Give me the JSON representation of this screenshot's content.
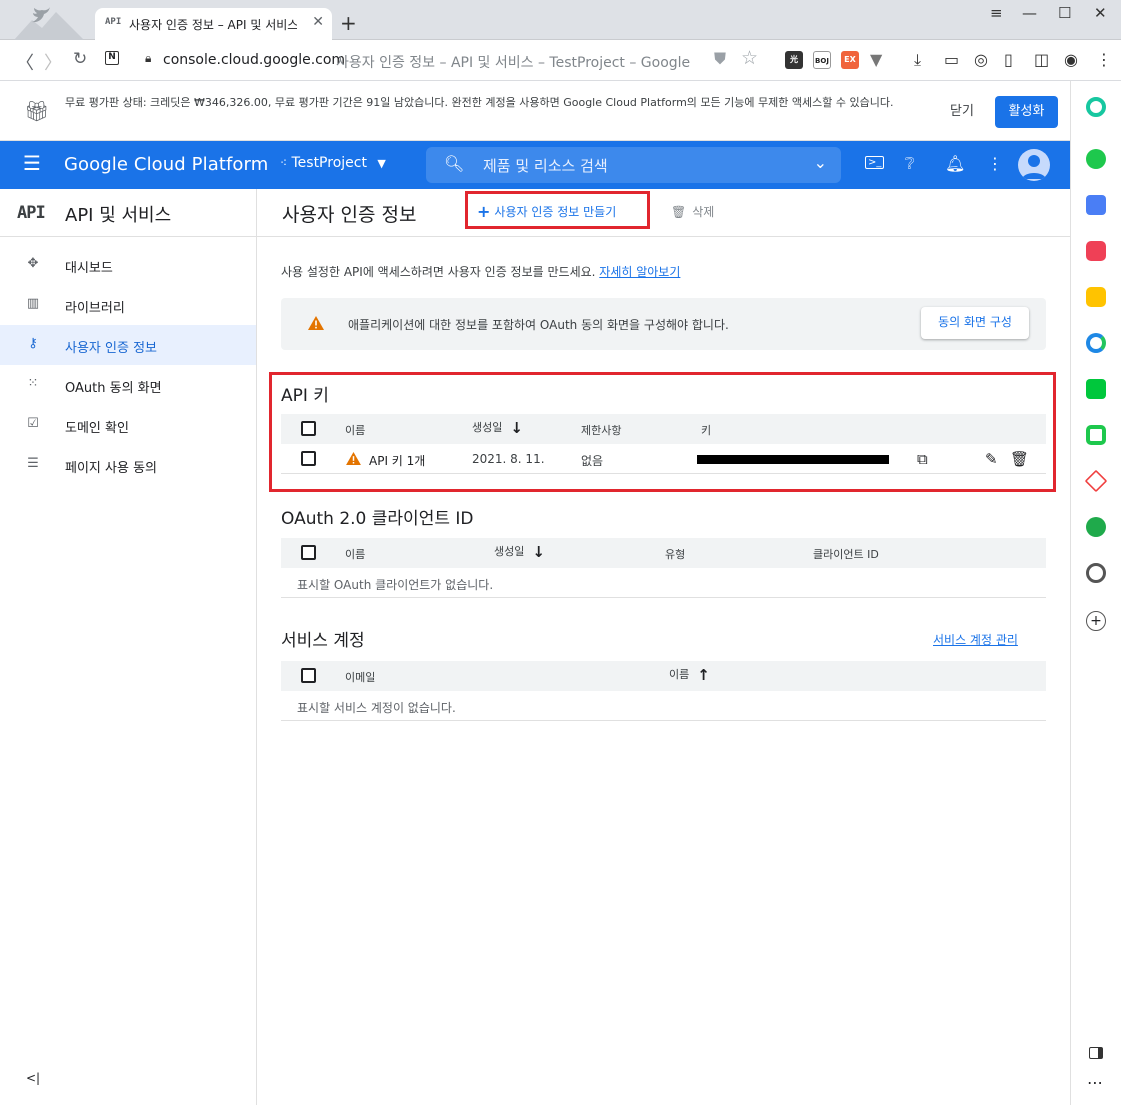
{
  "browser": {
    "tab_favicon": "API",
    "tab_title": "사용자 인증 정보 – API 및 서비스",
    "url_host": "console.cloud.google.com",
    "url_rest": "사용자 인증 정보 – API 및 서비스 – TestProject – Google",
    "ext_labels": [
      "光",
      "BOJ",
      "EX"
    ]
  },
  "promo": {
    "message": "무료 평가판 상태: 크레딧은 ₩346,326.00, 무료 평가판 기간은 91일 남았습니다. 완전한 계정을 사용하면 Google Cloud Platform의 모든 기능에 무제한 액세스할 수 있습니다.",
    "close": "닫기",
    "activate": "활성화"
  },
  "gcp": {
    "brand": "Google Cloud Platform",
    "project": "TestProject",
    "search_placeholder": "제품 및 리소스 검색"
  },
  "sidebar": {
    "logo": "API",
    "title": "API 및 서비스",
    "items": [
      {
        "label": "대시보드",
        "icon": "dashboard-icon"
      },
      {
        "label": "라이브러리",
        "icon": "library-icon"
      },
      {
        "label": "사용자 인증 정보",
        "icon": "key-icon"
      },
      {
        "label": "OAuth 동의 화면",
        "icon": "consent-icon"
      },
      {
        "label": "도메인 확인",
        "icon": "domain-check-icon"
      },
      {
        "label": "페이지 사용 동의",
        "icon": "page-usage-icon"
      }
    ],
    "collapse": "<|"
  },
  "page": {
    "title": "사용자 인증 정보",
    "create": "사용자 인증 정보 만들기",
    "delete": "삭제",
    "intro": "사용 설정한 API에 액세스하려면 사용자 인증 정보를 만드세요.",
    "learn_more": "자세히 알아보기",
    "warning": "애플리케이션에 대한 정보를 포함하여 OAuth 동의 화면을 구성해야 합니다.",
    "configure": "동의 화면 구성"
  },
  "api_keys": {
    "title": "API 키",
    "columns": [
      "이름",
      "생성일",
      "제한사항",
      "키"
    ],
    "rows": [
      {
        "name": "API 키 1개",
        "created": "2021. 8. 11.",
        "restrictions": "없음"
      }
    ]
  },
  "oauth": {
    "title": "OAuth 2.0 클라이언트 ID",
    "columns": [
      "이름",
      "생성일",
      "유형",
      "클라이언트 ID"
    ],
    "empty": "표시할 OAuth 클라이언트가 없습니다."
  },
  "service_accounts": {
    "title": "서비스 계정",
    "manage": "서비스 계정 관리",
    "columns": [
      "이메일",
      "이름"
    ],
    "empty": "표시할 서비스 계정이 없습니다."
  },
  "colors": {
    "primary": "#1a73e8",
    "highlight": "#e1262e",
    "warning": "#e37400"
  }
}
